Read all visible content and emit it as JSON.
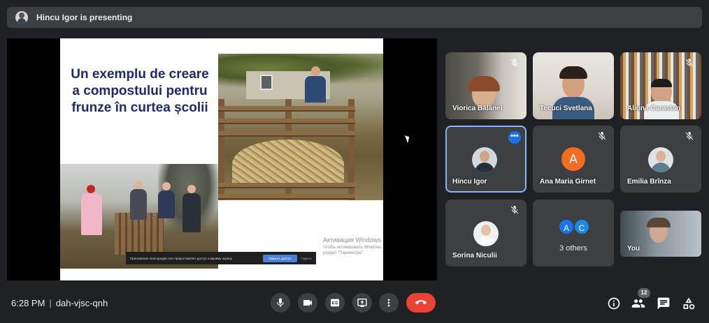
{
  "presenting_bar": {
    "text": "Hincu Igor is presenting"
  },
  "slide": {
    "title": "Un exemplu de creare a compostului pentru frunze în curtea școlii",
    "notification": {
      "text": "Приложение meet.google.com предоставляет доступ к вашему экрану.",
      "share_button": "Закрыть доступ",
      "hide_link": "Скрыть"
    },
    "windows_activation": {
      "title": "Активация Windows",
      "text": "Чтобы активировать Windows, перейдите в раздел \"Параметры\"."
    }
  },
  "participants": [
    {
      "name": "Viorica Bălănel",
      "muted": true
    },
    {
      "name": "Tecuci Svetlana",
      "muted": false
    },
    {
      "name": "Aliona Carastan",
      "muted": true
    },
    {
      "name": "Hincu Igor",
      "muted": false,
      "more": "•••"
    },
    {
      "name": "Ana Maria Girnet",
      "muted": true,
      "letter": "A",
      "color": "#f36c22"
    },
    {
      "name": "Emilia Brînza",
      "muted": true
    },
    {
      "name": "Sorina Niculii",
      "muted": true
    },
    {
      "name": "3 others",
      "letters": [
        "A",
        "C"
      ],
      "letter_colors": [
        "#1a73e8",
        "#1e88e5"
      ]
    },
    {
      "name": "You",
      "muted": false
    }
  ],
  "bottom_bar": {
    "time": "6:28 PM",
    "separator": "|",
    "meeting_code": "dah-vjsc-qnh",
    "people_count": "12"
  },
  "icons": {
    "mic": "mic-icon",
    "camera": "camera-icon",
    "captions": "captions-icon",
    "present": "present-icon",
    "more": "more-vert-icon",
    "end_call": "phone-hangup-icon",
    "info": "info-icon",
    "people": "people-icon",
    "chat": "chat-icon",
    "activities": "activities-icon"
  },
  "colors": {
    "background": "#202124",
    "tile": "#3c4043",
    "end_call": "#ea4335",
    "active_border": "#8ab4f8"
  }
}
